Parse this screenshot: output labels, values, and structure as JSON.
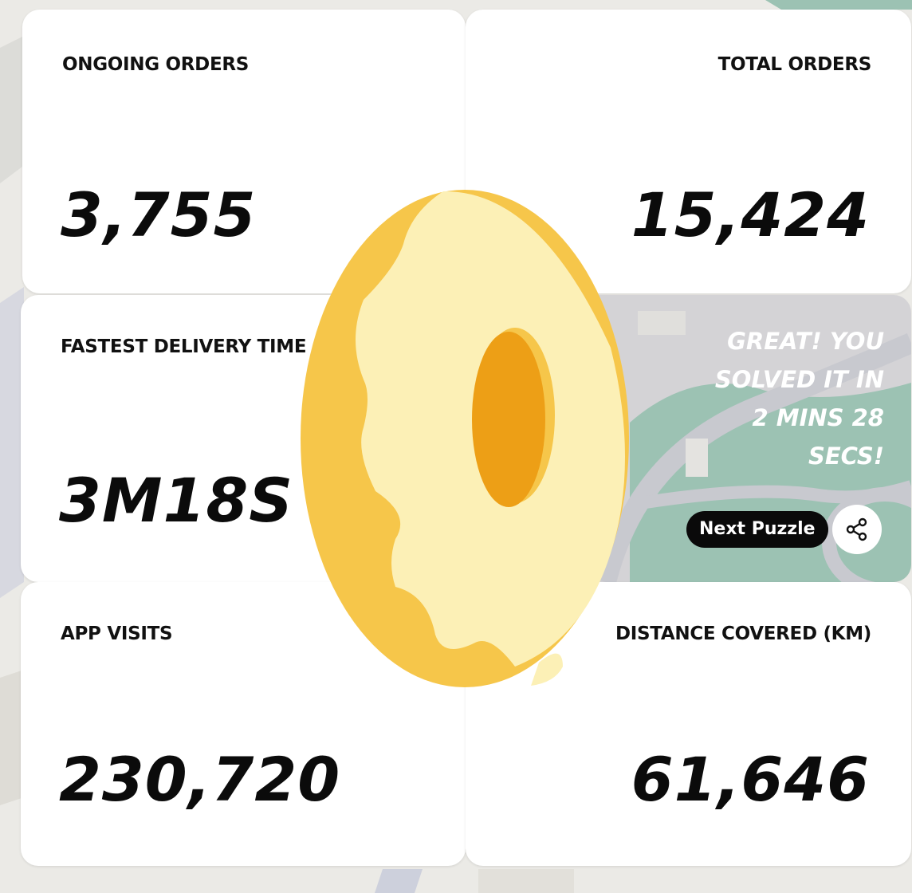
{
  "stats": {
    "ongoing": {
      "label": "ONGOING ORDERS",
      "value": "3,755"
    },
    "total": {
      "label": "TOTAL ORDERS",
      "value": "15,424"
    },
    "fastest": {
      "label": "FASTEST DELIVERY TIME",
      "value": "3M18S"
    },
    "visits": {
      "label": "APP VISITS",
      "value": "230,720"
    },
    "distance": {
      "label": "DISTANCE COVERED (KM)",
      "value": "61,646"
    }
  },
  "result": {
    "message": "GREAT! YOU SOLVED IT IN 2 MINS 28 SECS!",
    "next_label": "Next Puzzle",
    "share_icon": "share-icon"
  },
  "colors": {
    "donut_dough": "#f6c64a",
    "donut_icing": "#fcf0b6",
    "donut_hole": "#ed9f16",
    "map_green": "#9cc2b3",
    "map_road": "#cfcfd2"
  }
}
